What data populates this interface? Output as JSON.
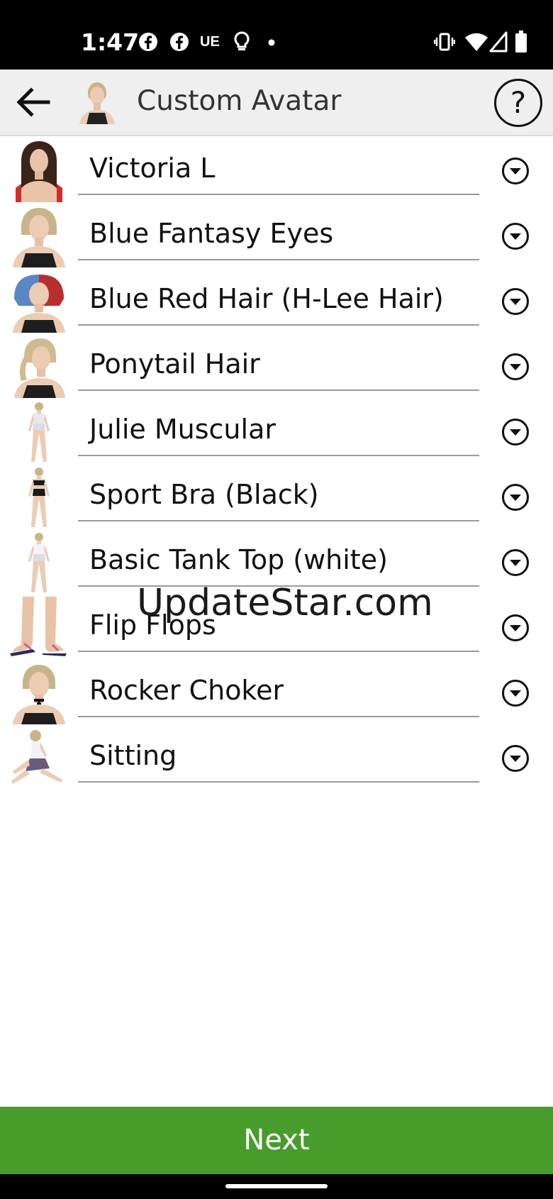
{
  "status_bar": {
    "time": "1:47",
    "notification_icons": [
      "facebook-icon",
      "facebook-icon",
      "ue-icon",
      "lightbulb-icon",
      "dot-icon"
    ],
    "ue_text": "UE",
    "system_icons": [
      "vibrate-icon",
      "wifi-icon",
      "signal-icon",
      "battery-icon"
    ]
  },
  "app_bar": {
    "title": "Custom Avatar",
    "help_label": "?"
  },
  "items": [
    {
      "label": "Victoria L",
      "thumb": "figure-dark-hair"
    },
    {
      "label": "Blue Fantasy Eyes",
      "thumb": "figure-blonde"
    },
    {
      "label": "Blue Red Hair (H-Lee Hair)",
      "thumb": "figure-blue-red-hair"
    },
    {
      "label": "Ponytail Hair",
      "thumb": "figure-ponytail"
    },
    {
      "label": "Julie Muscular",
      "thumb": "figure-full-body-white"
    },
    {
      "label": "Sport Bra (Black)",
      "thumb": "figure-full-body-black"
    },
    {
      "label": "Basic Tank Top (white)",
      "thumb": "figure-full-body-white"
    },
    {
      "label": "Flip Flops",
      "thumb": "feet-flip-flops"
    },
    {
      "label": "Rocker Choker",
      "thumb": "figure-choker"
    },
    {
      "label": "Sitting",
      "thumb": "figure-sitting"
    }
  ],
  "watermark": "UpdateStar.com",
  "next_label": "Next",
  "colors": {
    "accent": "#479c2b",
    "appbar": "#efefef",
    "statusbar": "#000000"
  }
}
